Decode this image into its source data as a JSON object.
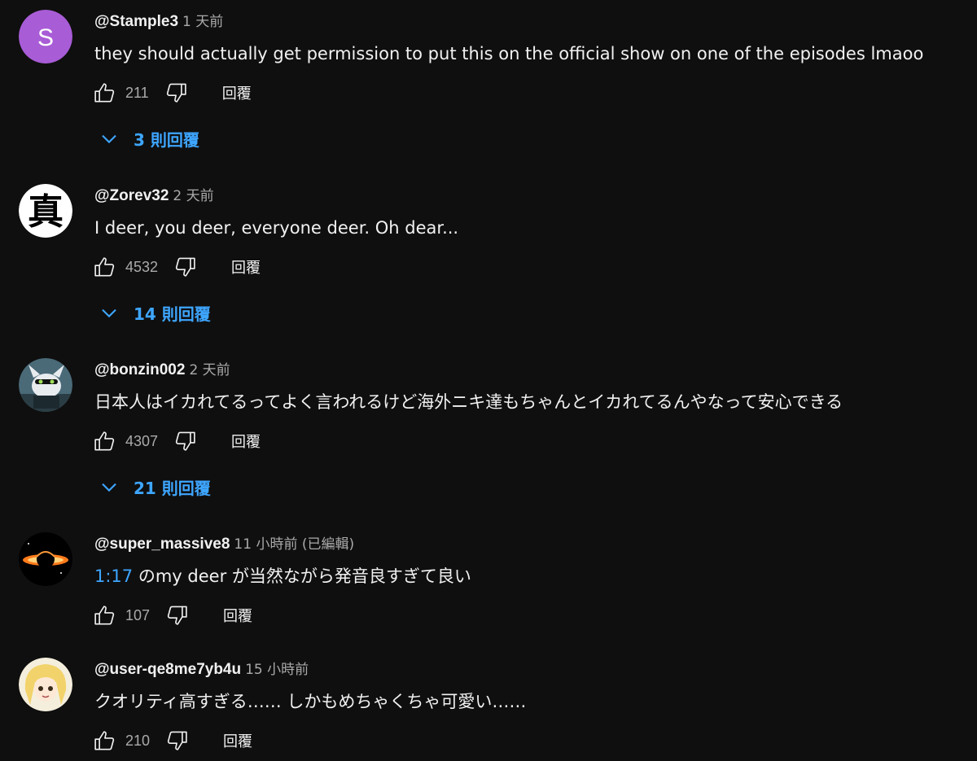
{
  "comments": [
    {
      "author": "@Stample3",
      "time": "1 天前",
      "text": "they should actually get permission to put this on the official show on one of the episodes lmaoo",
      "likes": "211",
      "reply_label": "回覆",
      "replies_label": "3 則回覆",
      "avatar_letter": "S",
      "avatar_color": "#a85cd6"
    },
    {
      "author": "@Zorev32",
      "time": "2 天前",
      "text": "I deer, you deer, everyone deer. Oh dear...",
      "likes": "4532",
      "reply_label": "回覆",
      "replies_label": "14 則回覆",
      "avatar_letter": "真",
      "avatar_color": "#ffffff"
    },
    {
      "author": "@bonzin002",
      "time": "2 天前",
      "text": "日本人はイカれてるってよく言われるけど海外ニキ達もちゃんとイカれてるんやなって安心できる",
      "likes": "4307",
      "reply_label": "回覆",
      "replies_label": "21 則回覆",
      "avatar_color": "#4a6a78"
    },
    {
      "author": "@super_massive8",
      "time": "11 小時前 (已編輯)",
      "timestamp_link": "1:17",
      "text": " のmy deer が当然ながら発音良すぎて良い",
      "likes": "107",
      "reply_label": "回覆",
      "avatar_color": "#000000"
    },
    {
      "author": "@user-qe8me7yb4u",
      "time": "15 小時前",
      "text": "クオリティ高すぎる…… しかもめちゃくちゃ可愛い……",
      "likes": "210",
      "reply_label": "回覆",
      "avatar_color": "#f2d36b"
    }
  ],
  "icons": {
    "like": "thumbs-up-icon",
    "dislike": "thumbs-down-icon",
    "expand": "chevron-down-icon"
  },
  "colors": {
    "background": "#0f0f0f",
    "link": "#3ea6ff",
    "secondary_text": "#aaaaaa"
  }
}
